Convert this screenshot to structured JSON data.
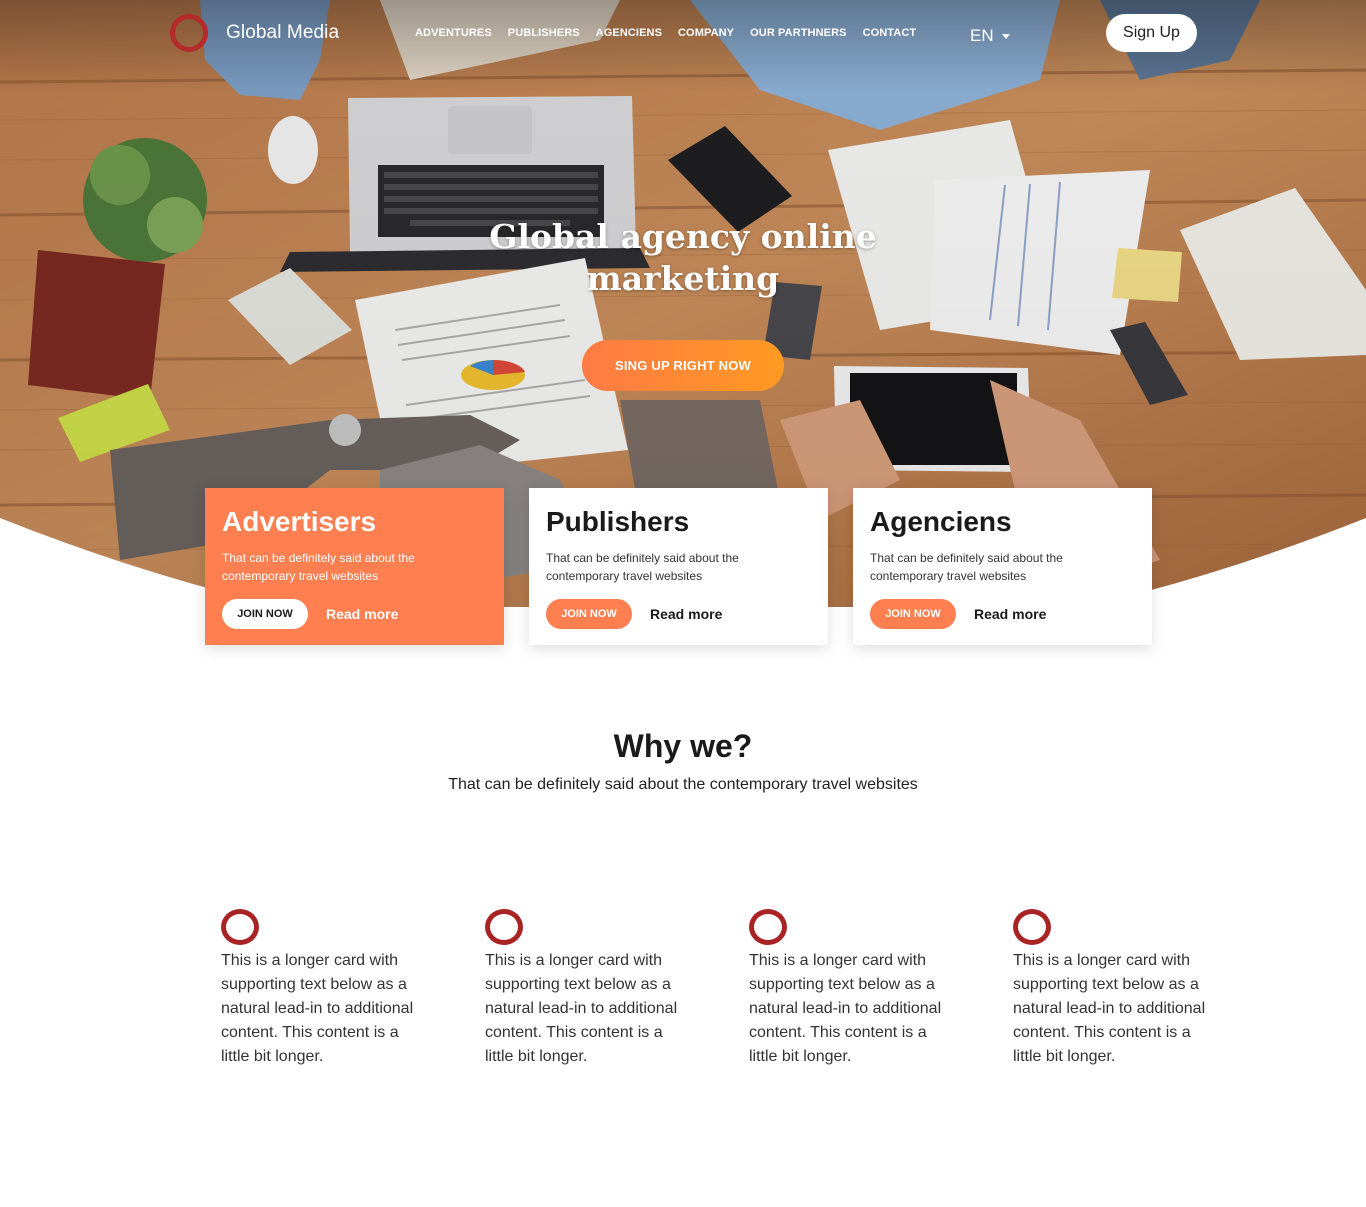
{
  "brand": {
    "name": "Global Media",
    "accent": "#ff7f50",
    "logo_color": "#b52a2a"
  },
  "nav": {
    "items": [
      "ADVENTURES",
      "PUBLISHERS",
      "AGENCIENS",
      "COMPANY",
      "OUR PARTHNERS",
      "CONTACT"
    ],
    "language": "EN",
    "signup_label": "Sign Up"
  },
  "hero": {
    "title": "Global agency online marketing",
    "cta_label": "SING UP RIGHT NOW"
  },
  "cards": [
    {
      "title": "Advertisers",
      "text": "That can be definitely said about the contemporary travel websites",
      "join": "JOIN NOW",
      "read": "Read more",
      "active": true
    },
    {
      "title": "Publishers",
      "text": "That can be definitely said about the contemporary travel websites",
      "join": "JOIN NOW",
      "read": "Read more",
      "active": false
    },
    {
      "title": "Agenciens",
      "text": "That can be definitely said about the contemporary travel websites",
      "join": "JOIN NOW",
      "read": "Read more",
      "active": false
    }
  ],
  "why": {
    "title": "Why we?",
    "subtitle": "That can be definitely said about the contemporary travel websites"
  },
  "features": [
    {
      "text": "This is a longer card with supporting text below as a natural lead-in to additional content. This content is a little bit longer.",
      "icon": "ring-icon"
    },
    {
      "text": "This is a longer card with supporting text below as a natural lead-in to additional content. This content is a little bit longer.",
      "icon": "ring-icon"
    },
    {
      "text": "This is a longer card with supporting text below as a natural lead-in to additional content. This content is a little bit longer.",
      "icon": "ring-icon"
    },
    {
      "text": "This is a longer card with supporting text below as a natural lead-in to additional content. This content is a little bit longer.",
      "icon": "ring-icon"
    }
  ]
}
